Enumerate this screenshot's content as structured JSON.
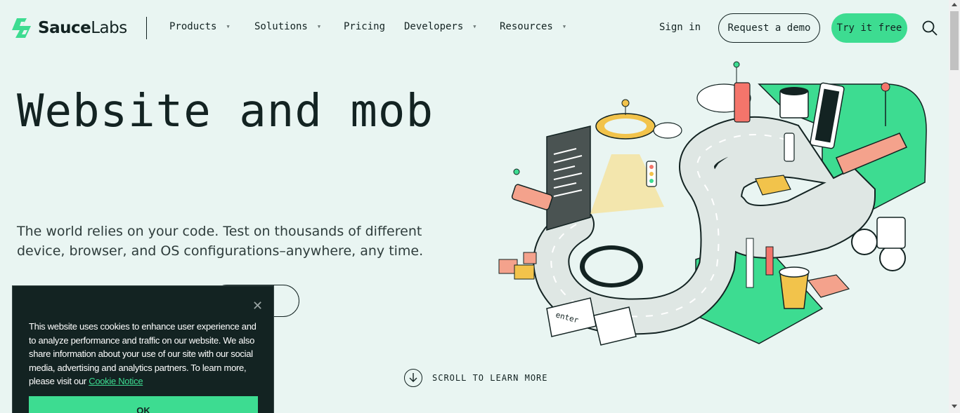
{
  "brand": {
    "name_part1": "Sauce",
    "name_part2": "Labs",
    "accent": "#3ddc91",
    "dark": "#132322",
    "background": "#e9f5f2"
  },
  "nav": {
    "items": [
      {
        "label": "Products",
        "has_dropdown": true
      },
      {
        "label": "Solutions",
        "has_dropdown": true
      },
      {
        "label": "Pricing",
        "has_dropdown": false
      },
      {
        "label": "Developers",
        "has_dropdown": true
      },
      {
        "label": "Resources",
        "has_dropdown": true
      }
    ],
    "sign_in": "Sign in",
    "request_demo": "Request a demo",
    "try_free": "Try it free",
    "search_icon": "search-icon"
  },
  "hero": {
    "title": "Website and mob",
    "subtitle_line1": "The world relies on your code. Test on thousands of different",
    "subtitle_line2": "device, browser, and OS configurations–anywhere, any time."
  },
  "scroll_prompt": "SCROLL TO LEARN MORE",
  "cookie": {
    "text": "This website uses cookies to enhance user experience and to analyze performance and traffic on our website. We also share information about your use of our site with our social media, advertising and analytics partners. To learn more, please visit our ",
    "link_label": "Cookie Notice",
    "ok_label": "OK",
    "close_glyph": "✕"
  },
  "illustration": {
    "enter_key": "enter"
  }
}
